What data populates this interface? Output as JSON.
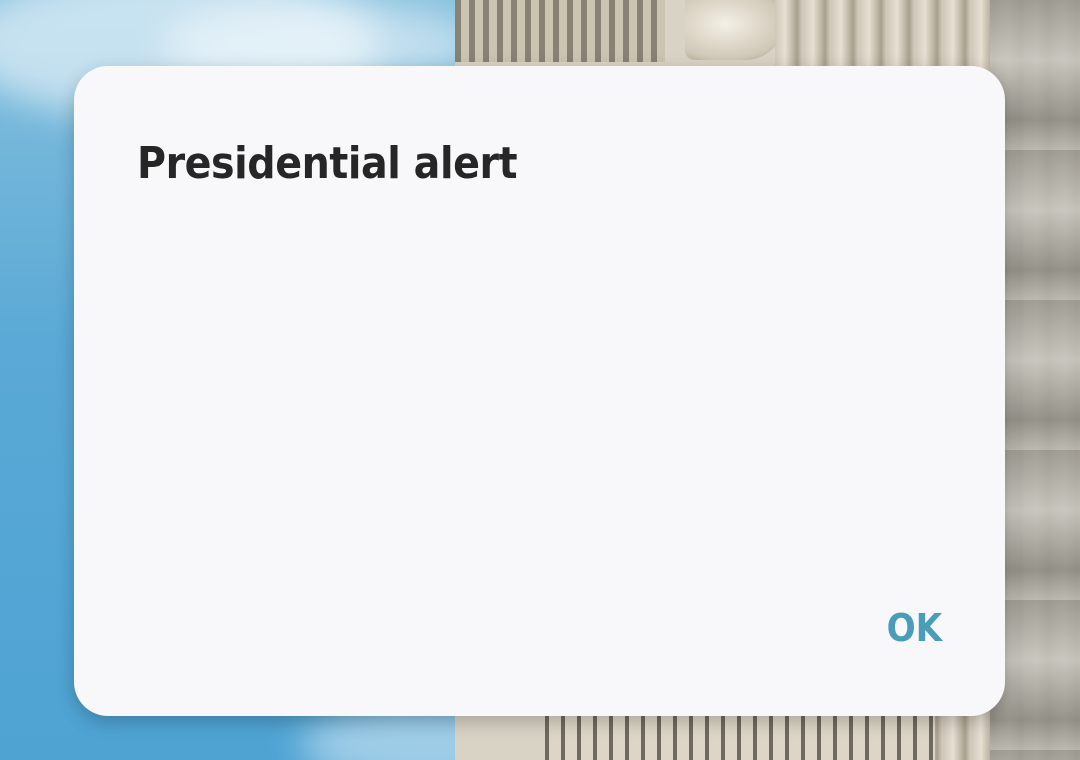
{
  "dialog": {
    "title": "Presidential alert",
    "body": "",
    "ok_label": "OK"
  },
  "colors": {
    "dialog_background": "#f8f8fa",
    "title_text": "#262626",
    "button_accent": "#4a9db9",
    "sky": "#5aa9d6"
  }
}
